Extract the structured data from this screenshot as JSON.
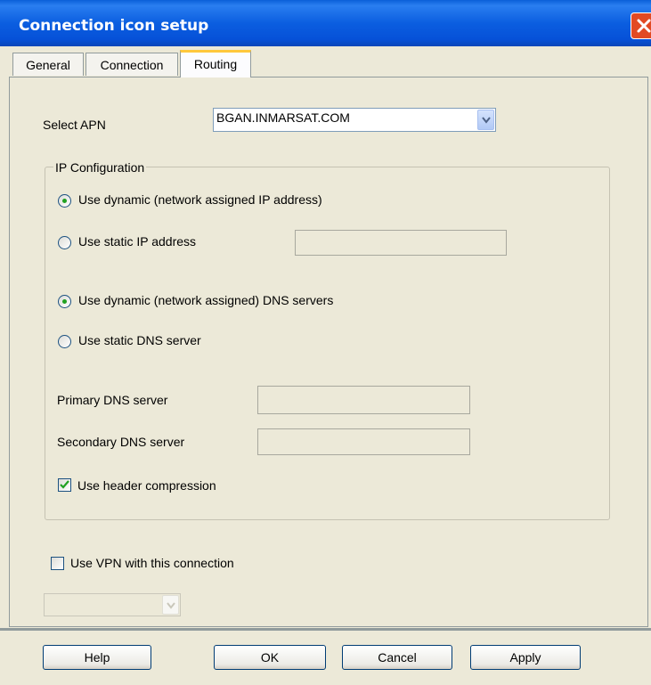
{
  "window": {
    "title": "Connection icon setup"
  },
  "tabs": [
    {
      "label": "General"
    },
    {
      "label": "Connection"
    },
    {
      "label": "Routing",
      "active": true
    }
  ],
  "apn": {
    "label": "Select APN",
    "value": "BGAN.INMARSAT.COM"
  },
  "ip_config": {
    "legend": "IP Configuration",
    "dynamic_ip": {
      "label": "Use dynamic (network assigned IP address)",
      "selected": true
    },
    "static_ip": {
      "label": "Use static IP address",
      "selected": false,
      "value": ""
    },
    "dynamic_dns": {
      "label": "Use dynamic (network assigned) DNS servers",
      "selected": true
    },
    "static_dns": {
      "label": "Use static DNS server",
      "selected": false
    },
    "primary_dns": {
      "label": "Primary DNS server",
      "value": ""
    },
    "secondary_dns": {
      "label": "Secondary DNS server",
      "value": ""
    },
    "header_compression": {
      "label": "Use header compression",
      "checked": true
    }
  },
  "vpn": {
    "label": "Use VPN with this connection",
    "checked": false,
    "value": ""
  },
  "buttons": {
    "help": "Help",
    "ok": "OK",
    "cancel": "Cancel",
    "apply": "Apply"
  },
  "icons": {
    "close": "close-icon",
    "dropdown": "chevron-down-icon",
    "check": "checkmark-icon"
  },
  "colors": {
    "titlebar": "#0a5fd8",
    "close": "#e24a24",
    "active_tab_accent": "#ffc83c",
    "radio_dot": "#21a121"
  }
}
